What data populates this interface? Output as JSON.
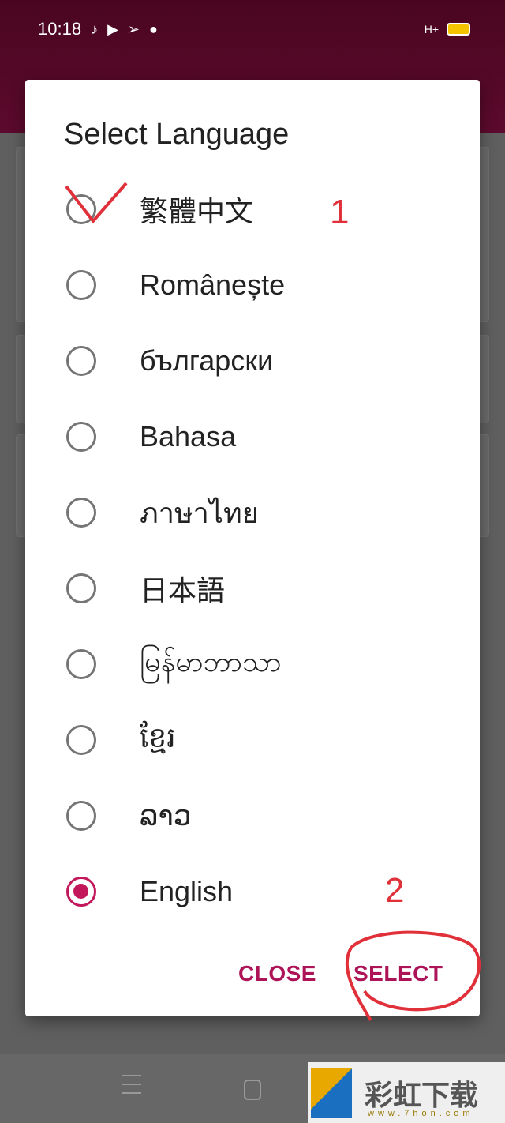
{
  "status_bar": {
    "time": "10:18",
    "icons": [
      "tiktok-icon",
      "youtube-icon",
      "send-icon",
      "dot-icon"
    ],
    "network": "H+",
    "battery_color": "#f5c400"
  },
  "dialog": {
    "title": "Select Language",
    "options": [
      {
        "label": "繁體中文",
        "selected": false
      },
      {
        "label": "Românește",
        "selected": false
      },
      {
        "label": "български",
        "selected": false
      },
      {
        "label": "Bahasa",
        "selected": false
      },
      {
        "label": "ภาษาไทย",
        "selected": false
      },
      {
        "label": "日本語",
        "selected": false
      },
      {
        "label": "မြန်မာဘာသာ",
        "selected": false
      },
      {
        "label": "ខ្មែរ",
        "selected": false
      },
      {
        "label": "ລາວ",
        "selected": false
      },
      {
        "label": "English",
        "selected": true
      }
    ],
    "close_label": "CLOSE",
    "select_label": "SELECT",
    "accent": "#c2185b"
  },
  "annotations": {
    "step1": "1",
    "step2": "2",
    "color": "#e0303a"
  },
  "watermark": {
    "text": "彩虹下载",
    "url": "www.7hon.com"
  }
}
